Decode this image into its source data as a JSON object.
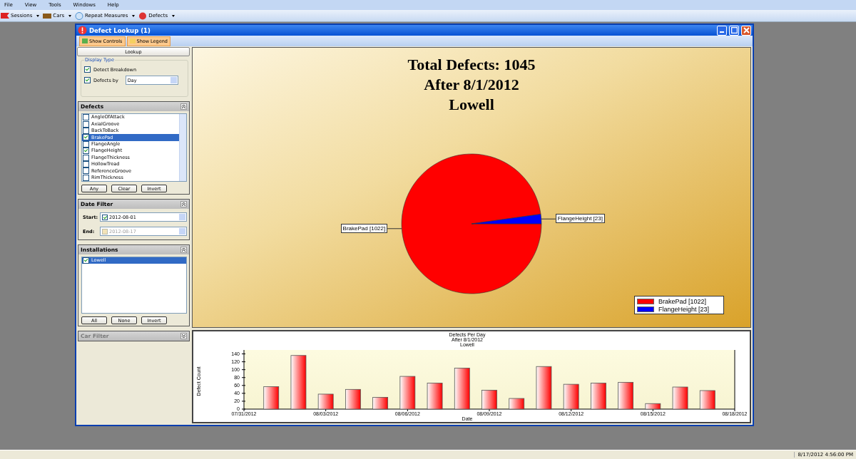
{
  "menu": [
    "File",
    "View",
    "Tools",
    "Windows",
    "Help"
  ],
  "toolbar": [
    {
      "label": "Sessions",
      "kind": "sessions"
    },
    {
      "label": "Cars",
      "kind": "cars"
    },
    {
      "label": "Repeat Measures",
      "kind": "repeat"
    },
    {
      "label": "Defects",
      "kind": "defects"
    }
  ],
  "window": {
    "title": "Defect Lookup (1)",
    "buttons": [
      "Show Controls",
      "Show Legend"
    ]
  },
  "controls": {
    "lookup": "Lookup",
    "display_type": {
      "title": "Display Type",
      "breakdown": {
        "label": "Detect Breakdown",
        "checked": true
      },
      "by": {
        "label": "Defects by",
        "checked": true,
        "value": "Day"
      }
    },
    "defects": {
      "title": "Defects",
      "items": [
        {
          "label": "AngleOfAttack",
          "checked": false,
          "selected": false
        },
        {
          "label": "AxialGroove",
          "checked": false,
          "selected": false
        },
        {
          "label": "BackToBack",
          "checked": false,
          "selected": false
        },
        {
          "label": "BrakePad",
          "checked": true,
          "selected": true
        },
        {
          "label": "FlangeAngle",
          "checked": false,
          "selected": false
        },
        {
          "label": "FlangeHeight",
          "checked": true,
          "selected": false
        },
        {
          "label": "FlangeThickness",
          "checked": false,
          "selected": false
        },
        {
          "label": "HollowTread",
          "checked": false,
          "selected": false
        },
        {
          "label": "ReferenceGroove",
          "checked": false,
          "selected": false
        },
        {
          "label": "RimThickness",
          "checked": false,
          "selected": false
        }
      ],
      "buttons": [
        "Any",
        "Clear",
        "Invert"
      ]
    },
    "date_filter": {
      "title": "Date Filter",
      "fields": [
        {
          "label": "Start:",
          "value": "2012-08-01",
          "checked": true
        },
        {
          "label": "End:",
          "value": "2012-08-17",
          "checked": false
        }
      ]
    },
    "installations": {
      "title": "Installations",
      "items": [
        {
          "label": "Lowell",
          "checked": true,
          "selected": true
        }
      ],
      "buttons": [
        "All",
        "None",
        "Invert"
      ]
    },
    "car_filter": {
      "title": "Car Filter",
      "disabled": true
    }
  },
  "pie_panel": {
    "subtitles": [
      "After 8/1/2012",
      "Lowell"
    ],
    "chart_data": {
      "type": "pie",
      "title": "Total Defects: 1045",
      "categories": [
        "BrakePad [1022]",
        "FlangeHeight [23]"
      ],
      "values": [
        1022,
        23
      ],
      "colors": [
        "#ff0000",
        "#0000ff"
      ],
      "legend": true
    }
  },
  "bar_panel": {
    "subtitles": [
      "After 8/1/2012",
      "Lowell"
    ],
    "chart_data": {
      "type": "bar",
      "title": "Defects Per Day",
      "xlabel": "Date",
      "ylabel": "Defect Count",
      "x": [
        "2012-08-01",
        "2012-08-02",
        "2012-08-03",
        "2012-08-04",
        "2012-08-05",
        "2012-08-06",
        "2012-08-07",
        "2012-08-08",
        "2012-08-09",
        "2012-08-10",
        "2012-08-11",
        "2012-08-12",
        "2012-08-13",
        "2012-08-14",
        "2012-08-15",
        "2012-08-16",
        "2012-08-17"
      ],
      "values": [
        57,
        136,
        38,
        50,
        30,
        83,
        66,
        104,
        48,
        27,
        108,
        63,
        66,
        68,
        14,
        56,
        47
      ],
      "xlim": [
        "2012-07-31",
        "2012-08-18"
      ],
      "ylim": [
        0,
        150
      ],
      "xticks": [
        {
          "value": "2012-07-31",
          "label": "07/31/2012"
        },
        {
          "value": "2012-08-03",
          "label": "08/03/2012"
        },
        {
          "value": "2012-08-06",
          "label": "08/06/2012"
        },
        {
          "value": "2012-08-09",
          "label": "08/09/2012"
        },
        {
          "value": "2012-08-12",
          "label": "08/12/2012"
        },
        {
          "value": "2012-08-15",
          "label": "08/15/2012"
        },
        {
          "value": "2012-08-18",
          "label": "08/18/2012"
        }
      ],
      "yticks": [
        0,
        20,
        40,
        60,
        80,
        100,
        120,
        140
      ]
    }
  },
  "status_bar": {
    "time": "8/17/2012 4:56:00 PM"
  }
}
